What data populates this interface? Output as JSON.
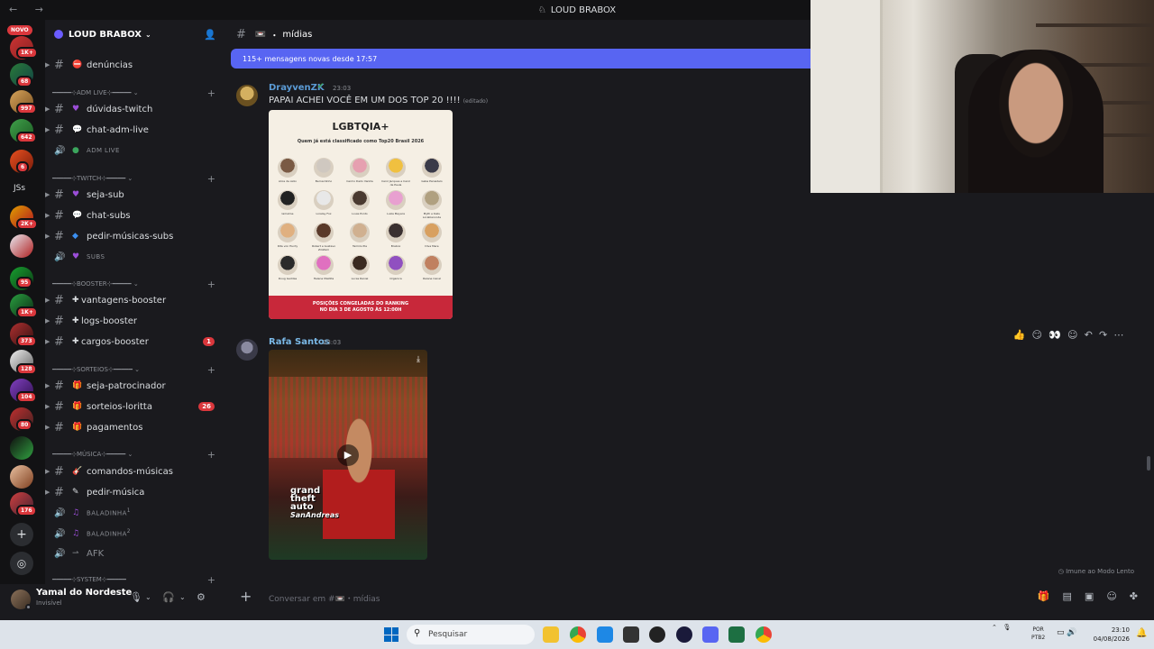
{
  "window": {
    "title": "LOUD BRABOX"
  },
  "rail": {
    "new_label": "NOVO",
    "badges": [
      "1K+",
      "68",
      "997",
      "642",
      "6",
      "2K+",
      "95",
      "1K+",
      "373",
      "128",
      "104",
      "80",
      "176"
    ],
    "text_server": "JSs"
  },
  "server": {
    "name": "LOUD BRABOX"
  },
  "channels": {
    "denuncias": "denúncias",
    "cat_adm": "ADM LIVE",
    "duvidas_twitch": "dúvidas-twitch",
    "chat_adm_live": "chat-adm-live",
    "adm_live_voice": "ADM LIVE",
    "cat_twitch": "TWITCH",
    "seja_sub": "seja-sub",
    "chat_subs": "chat-subs",
    "pedir_musicas_subs": "pedir-músicas-subs",
    "subs_voice": "SUBS",
    "cat_booster": "BOOSTER",
    "vantagens_booster": "vantagens-booster",
    "logs_booster": "logs-booster",
    "cargos_booster": "cargos-booster",
    "cargos_booster_badge": "1",
    "cat_sorteios": "SORTEIOS",
    "seja_patrocinador": "seja-patrocinador",
    "sorteios_loritta": "sorteios-loritta",
    "sorteios_loritta_badge": "26",
    "pagamentos": "pagamentos",
    "cat_musica": "MÚSICA",
    "comandos_musicas": "comandos-músicas",
    "pedir_musica": "pedir-música",
    "baladinha1": "BALADINHA",
    "baladinha1_sup": "1",
    "baladinha2": "BALADINHA",
    "baladinha2_sup": "2",
    "afk": "AFK",
    "cat_system": "SYSTEM"
  },
  "user": {
    "name": "Yamal do Nordeste",
    "status": "Invisível"
  },
  "chat": {
    "channel_name": "mídias",
    "new_messages_banner": "115+ mensagens novas desde 17:57",
    "messages": [
      {
        "author": "DrayvenZK",
        "time": "23:03",
        "text": "PAPAI ACHEI VOCÊ EM UM DOS TOP 20 !!!!",
        "edited": "(editado)",
        "author_color": "#5b9bd5"
      },
      {
        "author": "Rafa Santos",
        "time": "23:03",
        "author_color": "#7ab8e6"
      }
    ],
    "card": {
      "title": "LGBTQIA+",
      "subtitle": "Quem já está classificado como Top20 Brasil 2026",
      "people": [
        "Alice de Azzo",
        "Bernardinho",
        "Carmo Dado Vanilla",
        "Carol Jacques e Carol de Paula",
        "Gaba Paniadelo",
        "Iamaline",
        "Lorelay Fox",
        "Louie Ponto",
        "Luiza Mayara",
        "Myth e Kaliu Lorablancode",
        "Rita von Hunty",
        "Robert e Gustavo ZiloPam",
        "Tamiris Pia",
        "Brabox",
        "Diva Mere",
        "Doug Geddas",
        "Helena Maldita",
        "Lucas Raniel",
        "Organica",
        "Raiane Canal"
      ],
      "footer_line1": "POSIÇÕES CONGELADAS DO RANKING",
      "footer_line2": "NO DIA 3 DE AGOSTO ÀS 12:00H"
    },
    "video": {
      "logo_lines": [
        "grand",
        "theft",
        "auto",
        "SanAndreas"
      ]
    },
    "toolbar": [
      "👍",
      "😏",
      "👀",
      "☺",
      "↶",
      "↷",
      "⋯"
    ],
    "slowmode": "Imune ao Modo Lento",
    "composer_placeholder": "Conversar em #📼・mídias",
    "composer_tools": [
      "gift-icon",
      "gif-icon",
      "sticker-icon",
      "emoji-icon",
      "apps-icon"
    ]
  },
  "taskbar": {
    "search_placeholder": "Pesquisar",
    "lang_line1": "POR",
    "lang_line2": "PTB2",
    "time": "23:10",
    "date": "04/08/2026"
  },
  "colors": {
    "blurple": "#5865f2",
    "bg": "#1a1a1e",
    "rail": "#121214",
    "danger": "#da373c"
  }
}
